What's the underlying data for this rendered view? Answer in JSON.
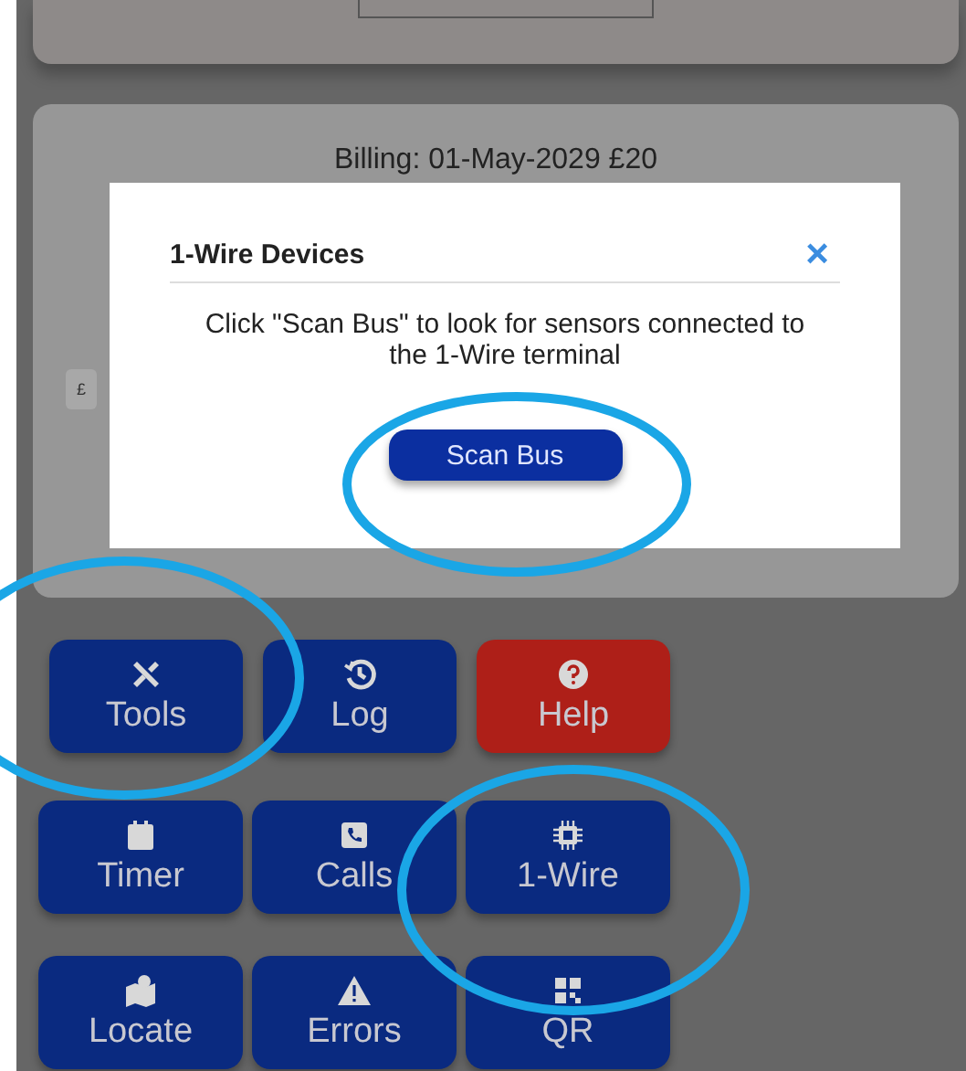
{
  "billing": "Billing: 01-May-2029 £20",
  "currency_field": "£",
  "dialog": {
    "title": "1-Wire Devices",
    "close": "×",
    "message": "Click \"Scan Bus\" to look for sensors connected to the 1-Wire terminal",
    "button": "Scan Bus"
  },
  "buttons": [
    {
      "label": "Tools",
      "kind": "primary"
    },
    {
      "label": "Log",
      "kind": "primary"
    },
    {
      "label": "Help",
      "kind": "danger"
    },
    {
      "label": "Timer",
      "kind": "primary"
    },
    {
      "label": "Calls",
      "kind": "primary"
    },
    {
      "label": "1-Wire",
      "kind": "primary"
    },
    {
      "label": "Locate",
      "kind": "primary"
    },
    {
      "label": "Errors",
      "kind": "primary"
    },
    {
      "label": "QR",
      "kind": "primary"
    }
  ]
}
